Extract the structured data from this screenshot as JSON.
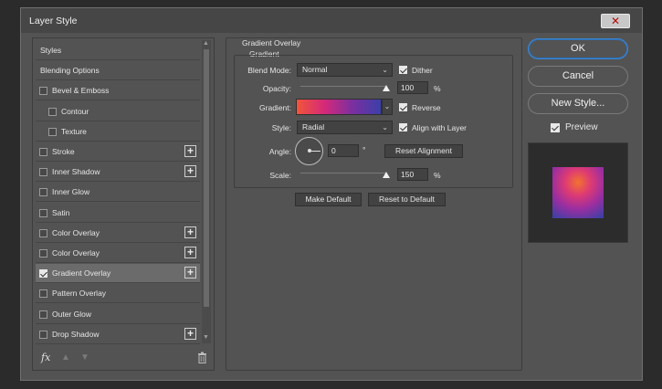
{
  "dialog": {
    "title": "Layer Style",
    "close_label": "✕"
  },
  "styles_list": {
    "items": [
      {
        "label": "Styles",
        "has_checkbox": false,
        "checked": false,
        "has_plus": false,
        "indent": false,
        "active": false
      },
      {
        "label": "Blending Options",
        "has_checkbox": false,
        "checked": false,
        "has_plus": false,
        "indent": false,
        "active": false
      },
      {
        "label": "Bevel & Emboss",
        "has_checkbox": true,
        "checked": false,
        "has_plus": false,
        "indent": false,
        "active": false
      },
      {
        "label": "Contour",
        "has_checkbox": true,
        "checked": false,
        "has_plus": false,
        "indent": true,
        "active": false
      },
      {
        "label": "Texture",
        "has_checkbox": true,
        "checked": false,
        "has_plus": false,
        "indent": true,
        "active": false
      },
      {
        "label": "Stroke",
        "has_checkbox": true,
        "checked": false,
        "has_plus": true,
        "indent": false,
        "active": false
      },
      {
        "label": "Inner Shadow",
        "has_checkbox": true,
        "checked": false,
        "has_plus": true,
        "indent": false,
        "active": false
      },
      {
        "label": "Inner Glow",
        "has_checkbox": true,
        "checked": false,
        "has_plus": false,
        "indent": false,
        "active": false
      },
      {
        "label": "Satin",
        "has_checkbox": true,
        "checked": false,
        "has_plus": false,
        "indent": false,
        "active": false
      },
      {
        "label": "Color Overlay",
        "has_checkbox": true,
        "checked": false,
        "has_plus": true,
        "indent": false,
        "active": false
      },
      {
        "label": "Color Overlay",
        "has_checkbox": true,
        "checked": false,
        "has_plus": true,
        "indent": false,
        "active": false
      },
      {
        "label": "Gradient Overlay",
        "has_checkbox": true,
        "checked": true,
        "has_plus": true,
        "indent": false,
        "active": true
      },
      {
        "label": "Pattern Overlay",
        "has_checkbox": true,
        "checked": false,
        "has_plus": false,
        "indent": false,
        "active": false
      },
      {
        "label": "Outer Glow",
        "has_checkbox": true,
        "checked": false,
        "has_plus": false,
        "indent": false,
        "active": false
      },
      {
        "label": "Drop Shadow",
        "has_checkbox": true,
        "checked": false,
        "has_plus": true,
        "indent": false,
        "active": false
      }
    ],
    "footer": {
      "fx_label": "fx",
      "up_arrow": "▲",
      "down_arrow": "▼"
    }
  },
  "gradient_overlay": {
    "section_title": "Gradient Overlay",
    "group_title": "Gradient",
    "blend_mode_label": "Blend Mode:",
    "blend_mode_value": "Normal",
    "dither_label": "Dither",
    "dither_checked": true,
    "opacity_label": "Opacity:",
    "opacity_value": "100",
    "opacity_unit": "%",
    "opacity_level": 1.0,
    "gradient_label": "Gradient:",
    "gradient_colors": [
      "#f2553a",
      "#d4297a",
      "#7a2fa0",
      "#3b3fa8"
    ],
    "reverse_label": "Reverse",
    "reverse_checked": true,
    "style_label": "Style:",
    "style_value": "Radial",
    "align_label": "Align with Layer",
    "align_checked": true,
    "angle_label": "Angle:",
    "angle_value": "0",
    "angle_unit": "°",
    "reset_alignment_label": "Reset Alignment",
    "scale_label": "Scale:",
    "scale_value": "150",
    "scale_unit": "%",
    "scale_level": 1.0,
    "make_default_label": "Make Default",
    "reset_default_label": "Reset to Default"
  },
  "right_panel": {
    "ok_label": "OK",
    "cancel_label": "Cancel",
    "new_style_label": "New Style...",
    "preview_label": "Preview",
    "preview_checked": true
  },
  "colors": {
    "dialog_bg": "#535353",
    "accent_blue": "#3b87d6",
    "close_red": "#b20c0c"
  }
}
